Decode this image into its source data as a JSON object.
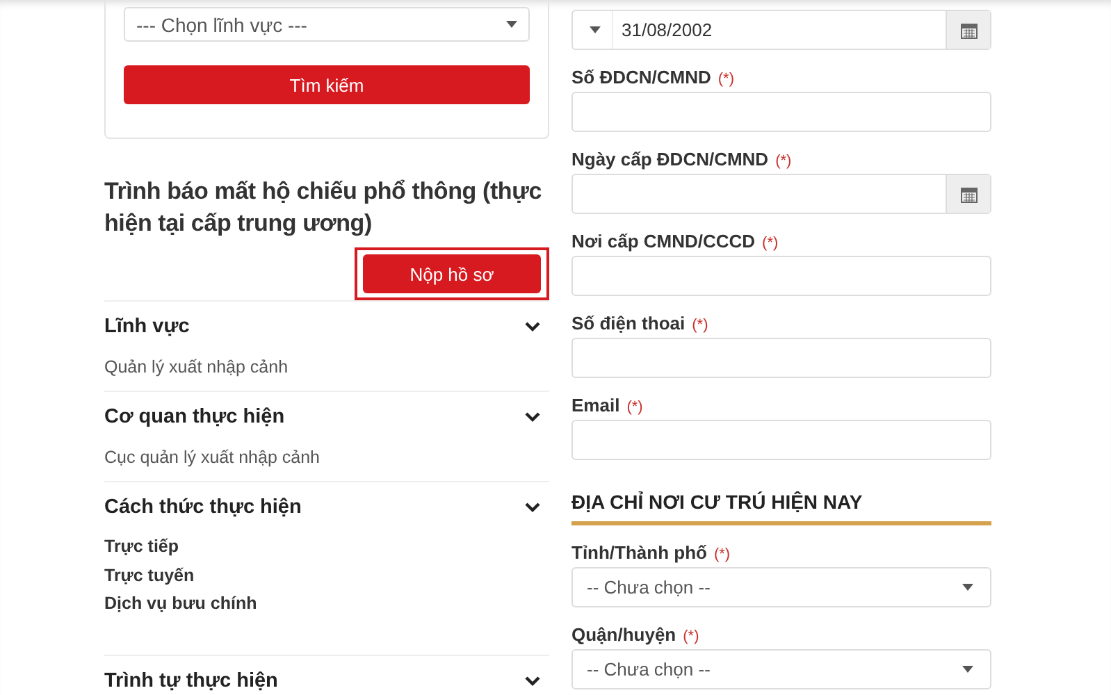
{
  "search_card": {
    "field_select": {
      "placeholder": "--- Chọn lĩnh vực ---"
    },
    "search_button": "Tìm kiếm"
  },
  "procedure": {
    "title": "Trình báo mất hộ chiếu phổ thông (thực hiện tại cấp trung ương)",
    "submit_button": "Nộp hồ sơ",
    "highlighted": true
  },
  "sections": [
    {
      "heading": "Lĩnh vực",
      "expanded": false,
      "kind": "text",
      "items": [
        "Quản lý xuất nhập cảnh"
      ]
    },
    {
      "heading": "Cơ quan thực hiện",
      "expanded": false,
      "kind": "text",
      "items": [
        "Cục quản lý xuất nhập cảnh"
      ]
    },
    {
      "heading": "Cách thức thực hiện",
      "expanded": false,
      "kind": "list",
      "items": [
        "Trực tiếp",
        "Trực tuyến",
        "Dịch vụ bưu chính"
      ]
    },
    {
      "heading": "Trình tự thực hiện",
      "expanded": false,
      "kind": "none"
    }
  ],
  "form": {
    "date_of_birth": {
      "value": "31/08/2002"
    },
    "fields": [
      {
        "label": "Số ĐDCN/CMND",
        "required": "(*)",
        "kind": "text"
      },
      {
        "label": "Ngày cấp ĐDCN/CMND",
        "required": "(*)",
        "kind": "date"
      },
      {
        "label": "Nơi cấp CMND/CCCD",
        "required": "(*)",
        "kind": "text"
      },
      {
        "label": "Số điện thoai",
        "required": "(*)",
        "kind": "text"
      },
      {
        "label": "Email",
        "required": "(*)",
        "kind": "text"
      }
    ],
    "address_heading": "ĐỊA CHỈ NƠI CƯ TRÚ HIỆN NAY",
    "address_fields": [
      {
        "label": "Tỉnh/Thành phố",
        "required": "(*)",
        "kind": "select",
        "placeholder": "-- Chưa chọn --"
      },
      {
        "label": "Quận/huyện",
        "required": "(*)",
        "kind": "select",
        "placeholder": "-- Chưa chọn --"
      }
    ]
  }
}
